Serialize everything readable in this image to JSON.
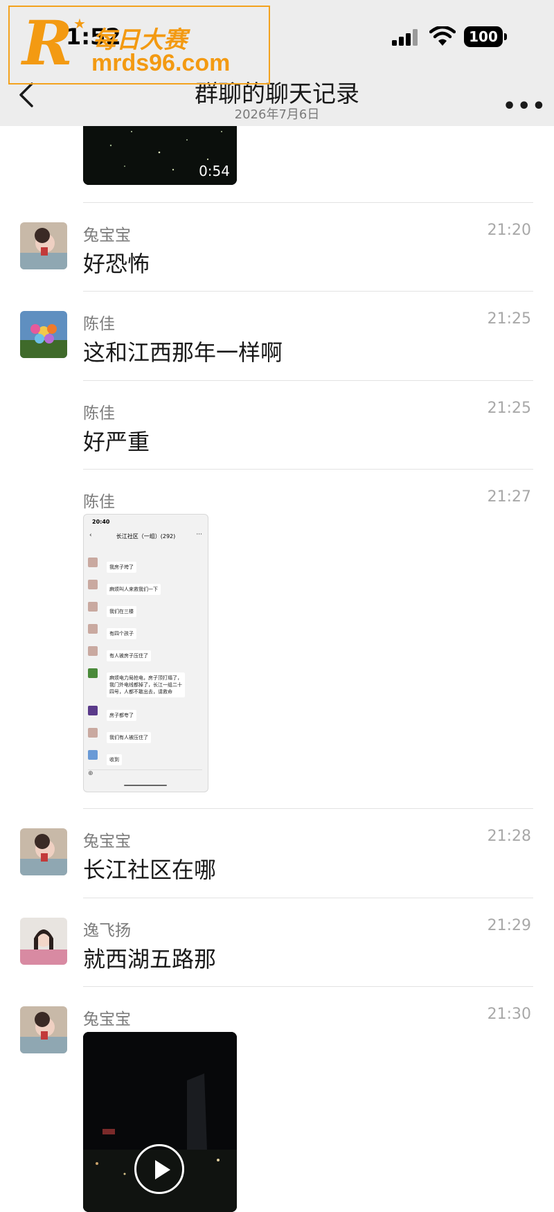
{
  "status_bar": {
    "time": "1:52",
    "battery": "100"
  },
  "header": {
    "title": "群聊的聊天记录",
    "date": "2026年7月6日"
  },
  "watermark": {
    "logo": "R",
    "cn": "每日大赛",
    "url": "mrds96.com"
  },
  "top_video": {
    "duration": "0:54"
  },
  "messages": [
    {
      "sender": "兔宝宝",
      "time": "21:20",
      "text": "好恐怖"
    },
    {
      "sender": "陈佳",
      "time": "21:25",
      "text": "这和江西那年一样啊"
    },
    {
      "sender": "陈佳",
      "time": "21:25",
      "text": "好严重"
    },
    {
      "sender": "陈佳",
      "time": "21:27"
    },
    {
      "sender": "兔宝宝",
      "time": "21:28",
      "text": "长江社区在哪"
    },
    {
      "sender": "逸飞扬",
      "time": "21:29",
      "text": "就西湖五路那"
    },
    {
      "sender": "兔宝宝",
      "time": "21:30"
    }
  ],
  "screenshot": {
    "status_time": "20:40",
    "title": "长江社区（一组）(292)",
    "bubbles": [
      "我房子垮了",
      "麻烦叫人来救我们一下",
      "我们在三楼",
      "有四个孩子",
      "有人被房子压住了",
      "麻烦电力局抢电，房子顶打塌了，\n我门外电线都掉了，长江一组二十\n四号，人都不敢出去，请救命",
      "房子都夸了",
      "我们有人被压住了",
      "收到"
    ]
  }
}
